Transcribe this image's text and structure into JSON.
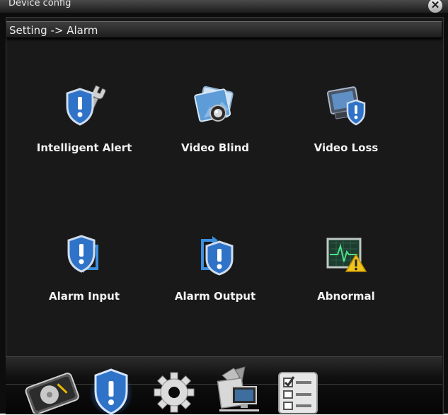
{
  "window": {
    "title": "Device config",
    "close_icon": "close-icon"
  },
  "breadcrumb": "Setting -> Alarm",
  "items": [
    {
      "label": "Intelligent Alert",
      "icon": "shield-wrench-icon"
    },
    {
      "label": "Video Blind",
      "icon": "photo-camera-icon"
    },
    {
      "label": "Video Loss",
      "icon": "tv-shield-icon"
    },
    {
      "label": "Alarm Input",
      "icon": "shield-arrow-in-icon"
    },
    {
      "label": "Alarm Output",
      "icon": "shield-arrow-out-icon"
    },
    {
      "label": "Abnormal",
      "icon": "monitor-warning-icon"
    }
  ],
  "toolbar": [
    {
      "icon": "hard-disk-icon"
    },
    {
      "icon": "alarm-shield-icon",
      "selected": true
    },
    {
      "icon": "gear-icon"
    },
    {
      "icon": "computer-tools-icon"
    },
    {
      "icon": "checklist-icon"
    }
  ],
  "colors": {
    "background": "#191919",
    "text": "#f2f2f2",
    "shield": "#2f73c8",
    "warning": "#f0c419"
  }
}
